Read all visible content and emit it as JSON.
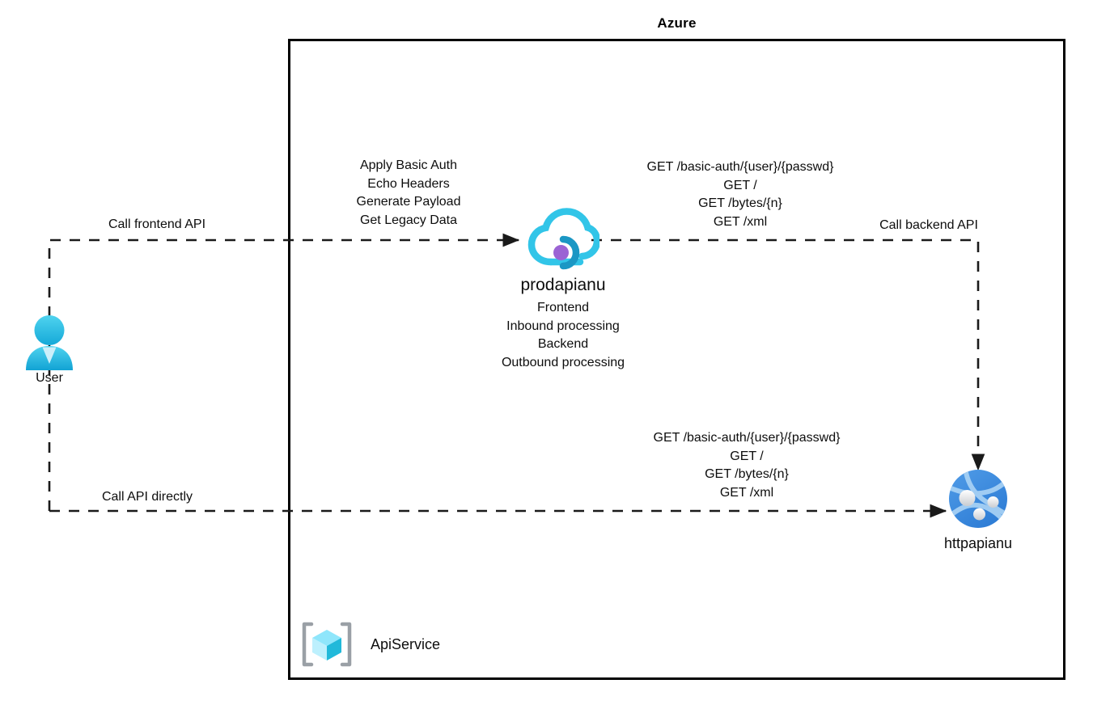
{
  "diagram": {
    "boundary": {
      "title": "Azure"
    },
    "actors": [
      {
        "id": "user",
        "icon": "user-person-icon",
        "label": "User"
      }
    ],
    "services": [
      {
        "id": "apim",
        "icon": "azure-api-management-cloud-icon",
        "label": "prodapianu",
        "sub_lines": "Frontend\nInbound processing\nBackend\nOutbound processing"
      },
      {
        "id": "appservice",
        "icon": "azure-app-service-globe-icon",
        "label": "httpapianu"
      }
    ],
    "resource_group": {
      "icon": "azure-resource-group-icon",
      "label": "ApiService"
    },
    "edge_labels": {
      "call_frontend": "Call frontend API",
      "call_backend": "Call backend API",
      "call_direct": "Call API directly",
      "policies": "Apply Basic Auth\nEcho Headers\nGenerate Payload\nGet Legacy Data",
      "backend_operations": "GET /basic-auth/{user}/{passwd}\nGET /\nGET /bytes/{n}\nGET /xml",
      "direct_operations": "GET /basic-auth/{user}/{passwd}\nGET /\nGET /bytes/{n}\nGET /xml"
    },
    "colors": {
      "line": "#1a1a1a",
      "boundary": "#000000",
      "apim_cloud": "#32c5e8",
      "apim_arc": "#1b97c4",
      "apim_dot": "#9b63d4",
      "appservice_blue": "#3e8ede",
      "user_cyan": "#2fc2e8",
      "resource_group_cube": "#4fd2f0",
      "resource_group_bracket": "#9aa0a6"
    }
  }
}
